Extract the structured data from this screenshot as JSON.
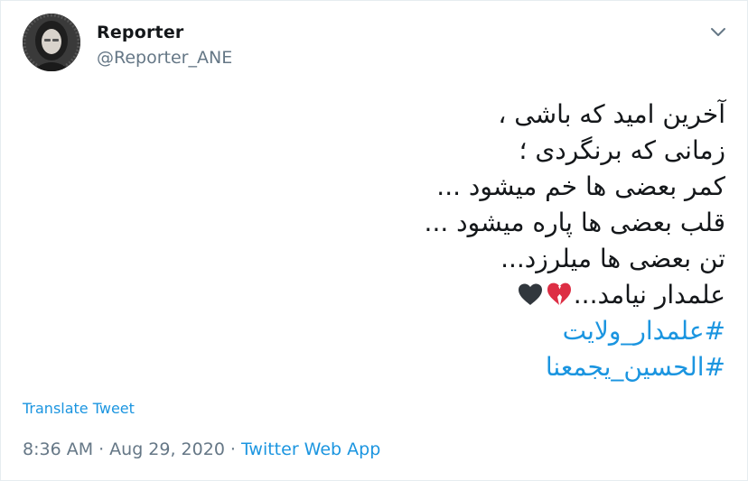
{
  "author": {
    "name": "Reporter",
    "handle": "@Reporter_ANE"
  },
  "icons": {
    "menu": "chevron-down-icon",
    "broken_heart": "broken-heart-emoji",
    "black_heart": "black-heart-emoji"
  },
  "tweet": {
    "lines": [
      "آخرین امید که باشی ،",
      "زمانی که برنگردی ؛",
      "کمر بعضی ها خم میشود ...",
      "قلب بعضی ها پاره میشود ...",
      "تن بعضی ها میلرزد...",
      "علمدار نیامد..."
    ],
    "hashtags": [
      "#علمدار_ولایت",
      "#الحسین_یجمعنا"
    ]
  },
  "translate_label": "Translate Tweet",
  "meta": {
    "time": "8:36 AM",
    "separator": "·",
    "date": "Aug 29, 2020",
    "source": "Twitter Web App"
  },
  "colors": {
    "text": "#14171a",
    "secondary": "#657786",
    "link": "#1b95e0",
    "broken_heart": "#dd2e44",
    "black_heart": "#31373d"
  }
}
